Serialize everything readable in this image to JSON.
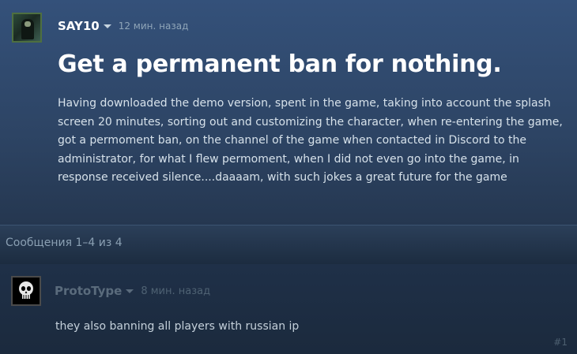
{
  "original_post": {
    "author": "SAY10",
    "time": "12 мин. назад",
    "title": "Get a permanent ban for nothing.",
    "body": "Having downloaded the demo version, spent in the game, taking into account the splash screen 20 minutes, sorting out and customizing the character, when re-entering the game, got a permoment ban, on the channel of the game when contacted in Discord to the administrator, for what I flew permoment, when I did not even go into the game, in response received silence....daaaam, with such jokes a great future for the game"
  },
  "thread": {
    "messages_count": "Сообщения 1–4 из 4"
  },
  "replies": [
    {
      "author": "ProtoType",
      "time": "8 мин. назад",
      "text": "they also banning all players with russian ip",
      "post_number": "#1"
    }
  ]
}
